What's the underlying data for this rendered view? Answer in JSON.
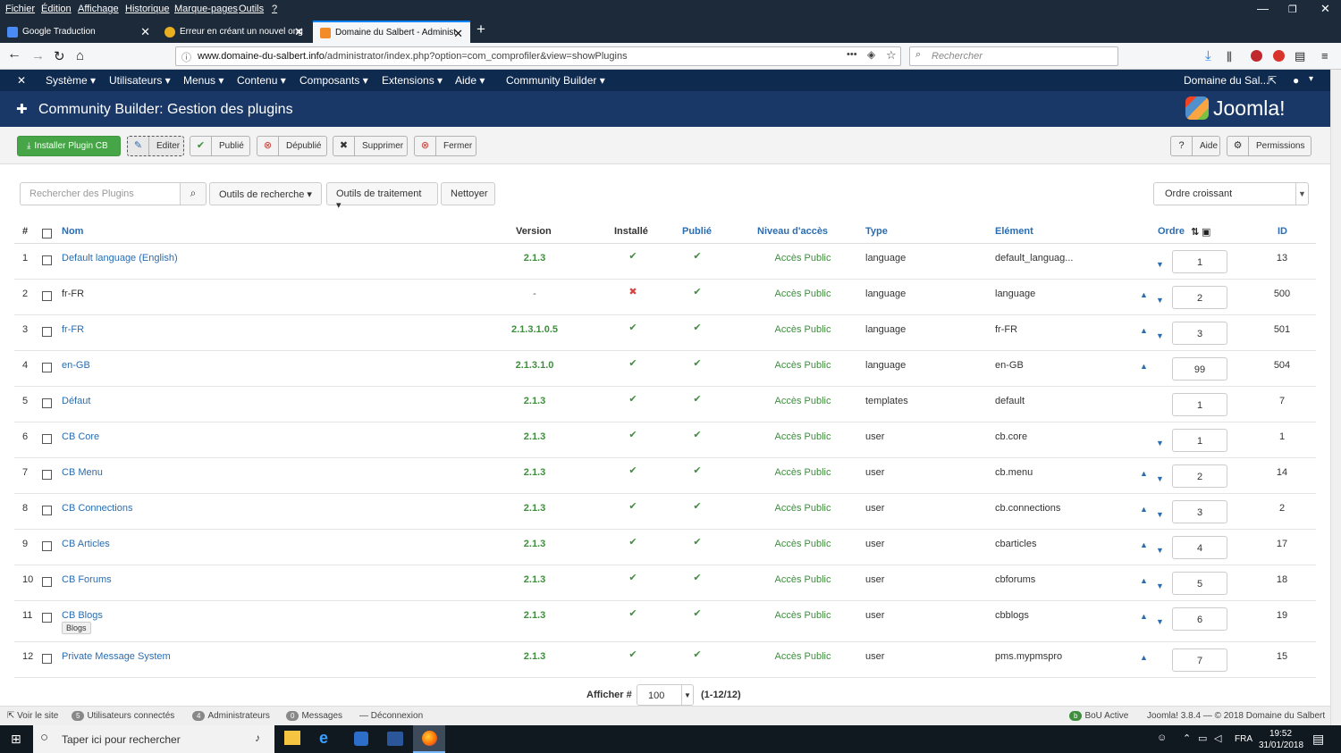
{
  "menubar": {
    "items": [
      "Fichier",
      "Édition",
      "Affichage",
      "Historique",
      "Marque-pages",
      "Outils",
      "?"
    ]
  },
  "tabs": [
    {
      "label": "Google Traduction"
    },
    {
      "label": "Erreur en créant un nouvel ong"
    },
    {
      "label": "Domaine du Salbert - Administ"
    }
  ],
  "nav": {
    "url_domain": "www.domaine-du-salbert.info",
    "url_path": "/administrator/index.php?option=com_comprofiler&view=showPlugins",
    "search_placeholder": "Rechercher",
    "menu_dots": "•••"
  },
  "jnav": {
    "items": [
      "Système ▾",
      "Utilisateurs ▾",
      "Menus ▾",
      "Contenu ▾",
      "Composants ▾",
      "Extensions ▾",
      "Aide ▾",
      "Community Builder ▾"
    ],
    "site": "Domaine du Sal...",
    "user": "▾"
  },
  "header": {
    "title": "Community Builder: Gestion des plugins",
    "logo": "Joomla!"
  },
  "toolbar": {
    "install": "Installer Plugin CB",
    "edit": "Editer",
    "publish": "Publié",
    "unpublish": "Dépublié",
    "delete": "Supprimer",
    "close": "Fermer",
    "help": "Aide",
    "permissions": "Permissions"
  },
  "filters": {
    "search_placeholder": "Rechercher des Plugins",
    "search_tools": "Outils de recherche ▾",
    "batch_tools": "Outils de traitement ▾",
    "clear": "Nettoyer",
    "order": "Ordre croissant"
  },
  "table": {
    "headers": {
      "num": "#",
      "name": "Nom",
      "version": "Version",
      "installed": "Installé",
      "published": "Publié",
      "access": "Niveau d'accès",
      "type": "Type",
      "element": "Elément",
      "order": "Ordre",
      "id": "ID"
    },
    "rows": [
      {
        "n": "1",
        "name": "Default language (English)",
        "link": true,
        "version": "2.1.3",
        "installed": true,
        "access": "Accès Public",
        "type": "language",
        "element": "default_languag...",
        "order": "1",
        "up": false,
        "down": true,
        "id": "13"
      },
      {
        "n": "2",
        "name": "fr-FR",
        "link": false,
        "version": "-",
        "installed": false,
        "access": "Accès Public",
        "type": "language",
        "element": "language",
        "order": "2",
        "up": true,
        "down": true,
        "id": "500"
      },
      {
        "n": "3",
        "name": "fr-FR",
        "link": true,
        "version": "2.1.3.1.0.5",
        "installed": true,
        "access": "Accès Public",
        "type": "language",
        "element": "fr-FR",
        "order": "3",
        "up": true,
        "down": true,
        "id": "501"
      },
      {
        "n": "4",
        "name": "en-GB",
        "link": true,
        "version": "2.1.3.1.0",
        "installed": true,
        "access": "Accès Public",
        "type": "language",
        "element": "en-GB",
        "order": "99",
        "up": true,
        "down": false,
        "id": "504"
      },
      {
        "n": "5",
        "name": "Défaut",
        "link": true,
        "version": "2.1.3",
        "installed": true,
        "access": "Accès Public",
        "type": "templates",
        "element": "default",
        "order": "1",
        "up": false,
        "down": false,
        "id": "7"
      },
      {
        "n": "6",
        "name": "CB Core",
        "link": true,
        "version": "2.1.3",
        "installed": true,
        "access": "Accès Public",
        "type": "user",
        "element": "cb.core",
        "order": "1",
        "up": false,
        "down": true,
        "id": "1"
      },
      {
        "n": "7",
        "name": "CB Menu",
        "link": true,
        "version": "2.1.3",
        "installed": true,
        "access": "Accès Public",
        "type": "user",
        "element": "cb.menu",
        "order": "2",
        "up": true,
        "down": true,
        "id": "14"
      },
      {
        "n": "8",
        "name": "CB Connections",
        "link": true,
        "version": "2.1.3",
        "installed": true,
        "access": "Accès Public",
        "type": "user",
        "element": "cb.connections",
        "order": "3",
        "up": true,
        "down": true,
        "id": "2"
      },
      {
        "n": "9",
        "name": "CB Articles",
        "link": true,
        "version": "2.1.3",
        "installed": true,
        "access": "Accès Public",
        "type": "user",
        "element": "cbarticles",
        "order": "4",
        "up": true,
        "down": true,
        "id": "17"
      },
      {
        "n": "10",
        "name": "CB Forums",
        "link": true,
        "version": "2.1.3",
        "installed": true,
        "access": "Accès Public",
        "type": "user",
        "element": "cbforums",
        "order": "5",
        "up": true,
        "down": true,
        "id": "18"
      },
      {
        "n": "11",
        "name": "CB Blogs",
        "link": true,
        "badge": "Blogs",
        "version": "2.1.3",
        "installed": true,
        "access": "Accès Public",
        "type": "user",
        "element": "cbblogs",
        "order": "6",
        "up": true,
        "down": true,
        "id": "19"
      },
      {
        "n": "12",
        "name": "Private Message System",
        "link": true,
        "version": "2.1.3",
        "installed": true,
        "access": "Accès Public",
        "type": "user",
        "element": "pms.mypmspro",
        "order": "7",
        "up": true,
        "down": false,
        "id": "15"
      }
    ]
  },
  "pager": {
    "label": "Afficher #",
    "value": "100",
    "range": "(1-12/12)"
  },
  "status": {
    "view_site": "Voir le site",
    "users_count": "5",
    "users": "Utilisateurs connectés",
    "admins_count": "4",
    "admins": "Administrateurs",
    "messages_count": "0",
    "messages": "Messages",
    "logout": "Déconnexion",
    "bou": "BoU Active",
    "version": "Joomla! 3.8.4 — © 2018 Domaine du Salbert"
  },
  "taskbar": {
    "search": "Taper ici pour rechercher",
    "lang": "FRA",
    "time": "19:52",
    "date": "31/01/2018"
  }
}
